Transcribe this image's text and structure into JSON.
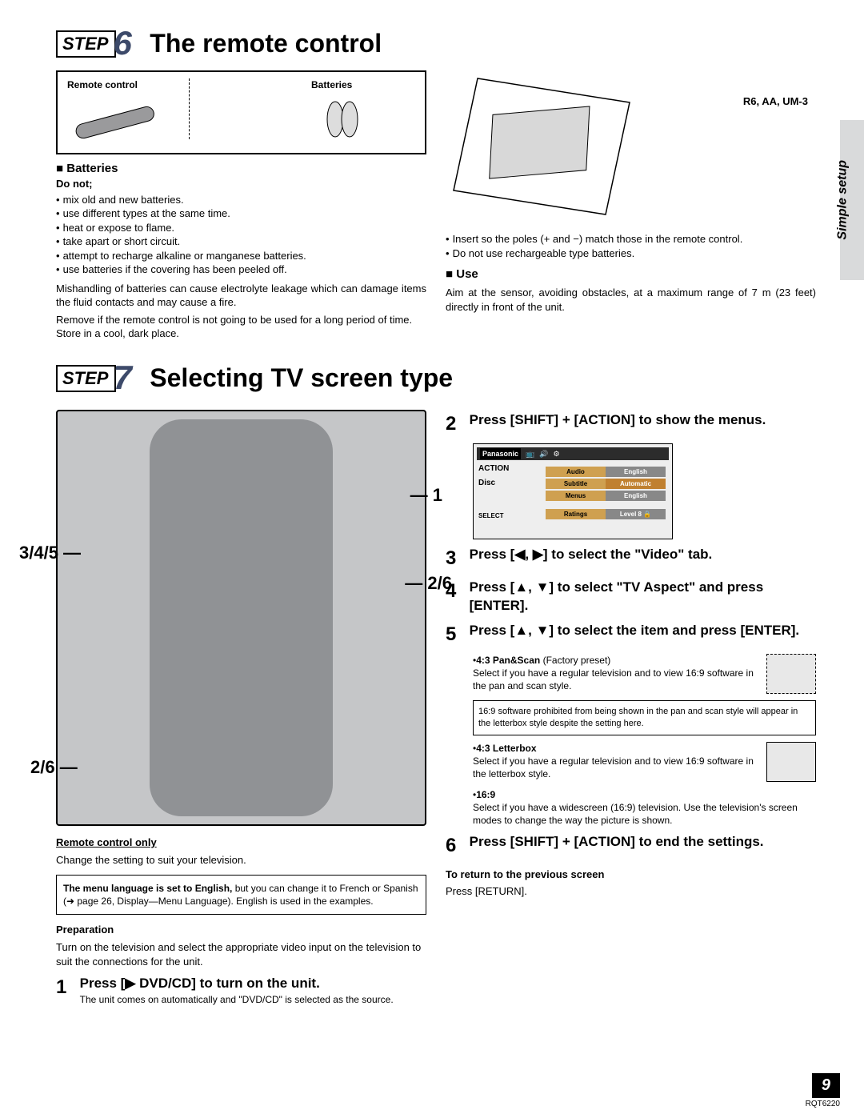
{
  "side_label": "Simple setup",
  "step6": {
    "label": "STEP",
    "num": "6",
    "title": "The remote control",
    "box_left": "Remote control",
    "box_right": "Batteries",
    "battery_label": "R6, AA, UM-3",
    "batteries_head": "Batteries",
    "do_not": "Do not;",
    "donts": [
      "mix old and new batteries.",
      "use different types at the same time.",
      "heat or expose to flame.",
      "take apart or short circuit.",
      "attempt to recharge alkaline or manganese batteries.",
      "use batteries if the covering has been peeled off."
    ],
    "mishandling": "Mishandling of batteries can cause electrolyte leakage which can damage items the fluid contacts and may cause a fire.",
    "remove": "Remove if the remote control is not going to be used for a long period of time. Store in a cool, dark place.",
    "insert_note": "Insert so the poles (+ and −) match those in the remote control.",
    "recharge_note": "Do not use rechargeable type batteries.",
    "use_head": "Use",
    "use_body": "Aim at the sensor, avoiding obstacles, at a maximum range of 7 m (23 feet) directly in front of the unit."
  },
  "step7": {
    "label": "STEP",
    "num": "7",
    "title": "Selecting TV screen type",
    "ptr_1": "1",
    "ptr_345": "3/4/5",
    "ptr_26": "2/6",
    "remote_only": "Remote control only",
    "change_setting": "Change the setting to suit your television.",
    "menu_lang_bold": "The menu language is set to English, ",
    "menu_lang_rest": "but you can change it to French or Spanish (➜ page 26, Display—Menu Language). English is used in the examples.",
    "preparation_head": "Preparation",
    "preparation_body": "Turn on the television and select the appropriate video input on the television to suit the connections for the unit.",
    "s1_num": "1",
    "s1": "Press [▶ DVD/CD] to turn on the unit.",
    "s1_sub": "The unit comes on automatically and \"DVD/CD\" is selected as the source.",
    "s2_num": "2",
    "s2": "Press [SHIFT] + [ACTION] to show the menus.",
    "menu": {
      "brand": "Panasonic",
      "action": "ACTION",
      "disc": "Disc",
      "select": "SELECT",
      "rows": [
        {
          "l": "Audio",
          "r": "English"
        },
        {
          "l": "Subtitle",
          "r": "Automatic"
        },
        {
          "l": "Menus",
          "r": "English"
        }
      ],
      "ratings_l": "Ratings",
      "ratings_r": "Level 8 🔒"
    },
    "s3_num": "3",
    "s3": "Press [◀, ▶] to select the \"Video\" tab.",
    "s4_num": "4",
    "s4": "Press [▲, ▼] to select \"TV Aspect\" and press [ENTER].",
    "s5_num": "5",
    "s5": "Press [▲, ▼] to select the item and press [ENTER].",
    "opt1_head": "4:3 Pan&Scan",
    "opt1_preset": " (Factory preset)",
    "opt1_body": "Select if you have a regular television and to view 16:9 software in the pan and scan style.",
    "opt1_note": "16:9 software prohibited from being shown in the pan and scan style will appear in the letterbox style despite the setting here.",
    "opt2_head": "4:3 Letterbox",
    "opt2_body": "Select if you have a regular television and to view 16:9 software in the letterbox style.",
    "opt3_head": "16:9",
    "opt3_body": "Select if you have a widescreen (16:9) television. Use the television's screen modes to change the way the picture is shown.",
    "s6_num": "6",
    "s6": "Press [SHIFT] + [ACTION] to end the settings.",
    "return_head": "To return to the previous screen",
    "return_body": "Press [RETURN]."
  },
  "footer": {
    "page": "9",
    "code": "RQT6220"
  }
}
